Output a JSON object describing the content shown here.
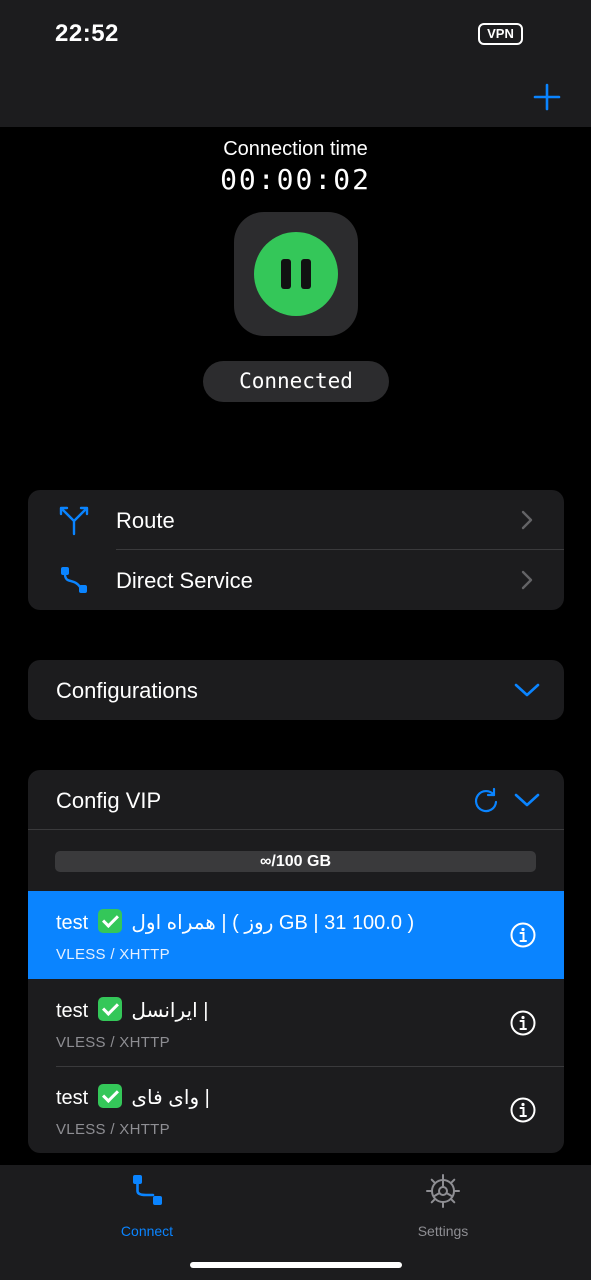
{
  "status_bar": {
    "time": "22:52",
    "vpn_badge": "VPN"
  },
  "header": {
    "add_icon": "plus-icon"
  },
  "connection": {
    "time_label": "Connection time",
    "time_value": "00:00:02",
    "status": "Connected",
    "button_color": "#34c759"
  },
  "menu": {
    "items": [
      {
        "label": "Route",
        "icon": "route-split-icon"
      },
      {
        "label": "Direct Service",
        "icon": "direct-path-icon"
      }
    ]
  },
  "configurations": {
    "title": "Configurations"
  },
  "config_vip": {
    "title": "Config VIP",
    "usage": "∞/100 GB",
    "servers": [
      {
        "name_prefix": "test",
        "name_suffix": "( 100.0 GB | 31 روز ) | همراه اول",
        "protocol": "VLESS / XHTTP",
        "selected": true
      },
      {
        "name_prefix": "test",
        "name_suffix": "| ایرانسل",
        "protocol": "VLESS / XHTTP",
        "selected": false
      },
      {
        "name_prefix": "test",
        "name_suffix": "| وای فای",
        "protocol": "VLESS / XHTTP",
        "selected": false
      }
    ]
  },
  "tabs": [
    {
      "label": "Connect",
      "icon": "connect-path-icon",
      "active": true
    },
    {
      "label": "Settings",
      "icon": "gear-icon",
      "active": false
    }
  ],
  "colors": {
    "accent": "#0a84ff",
    "connected": "#34c759",
    "inactive": "#8e8e93"
  }
}
